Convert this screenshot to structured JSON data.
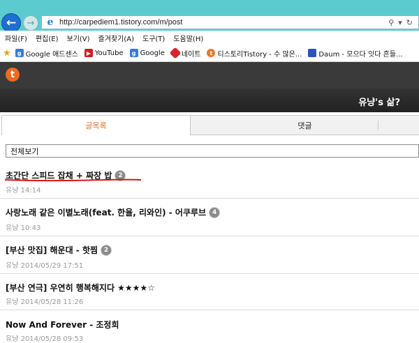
{
  "browser": {
    "url": "http://carpediem1.tistory.com/m/post",
    "menu": [
      "파일(F)",
      "편집(E)",
      "보기(V)",
      "즐겨찾기(A)",
      "도구(T)",
      "도움말(H)"
    ],
    "favorites": [
      {
        "label": "Google 애드센스",
        "icon": "google-icon",
        "color": "#3b7bd8"
      },
      {
        "label": "YouTube",
        "icon": "youtube-icon",
        "color": "#cc1f1f"
      },
      {
        "label": "Google",
        "icon": "google-icon",
        "color": "#3b7bd8"
      },
      {
        "label": "네이트",
        "icon": "nate-icon",
        "color": "#d7262b"
      },
      {
        "label": "티스토리Tistory - 수 많은...",
        "icon": "tistory-icon",
        "color": "#e8772e"
      },
      {
        "label": "Daum - 모으다 잇다 흔들...",
        "icon": "daum-icon",
        "color": "#2d55b8"
      }
    ]
  },
  "blog": {
    "title": "유냥's 삶?",
    "tabs": {
      "posts": "글목록",
      "comments": "댓글"
    },
    "category": "전체보기"
  },
  "posts": [
    {
      "title": "초간단 스피드 잡채 + 짜장 밥",
      "count": "2",
      "meta": "유냥 14:14"
    },
    {
      "title": "사랑노래 같은 이별노래(feat. 한율, 리와인) - 어쿠루브",
      "count": "4",
      "meta": "유냥 10:43"
    },
    {
      "title": "[부산 맛집] 해운대 - 핫찜",
      "count": "2",
      "meta": "유냥 2014/05/29 17:51"
    },
    {
      "title": "[부산 연극] 우연히 행복해지다 ★★★★☆",
      "count": "",
      "meta": "유냥 2014/05/28 11:26"
    },
    {
      "title": "Now And Forever - 조정희",
      "count": "",
      "meta": "유냥 2014/05/28 09:53"
    }
  ],
  "colors": {
    "accent": "#e0742c",
    "annotation": "#d9141b",
    "chrome": "#5bcbcf"
  }
}
